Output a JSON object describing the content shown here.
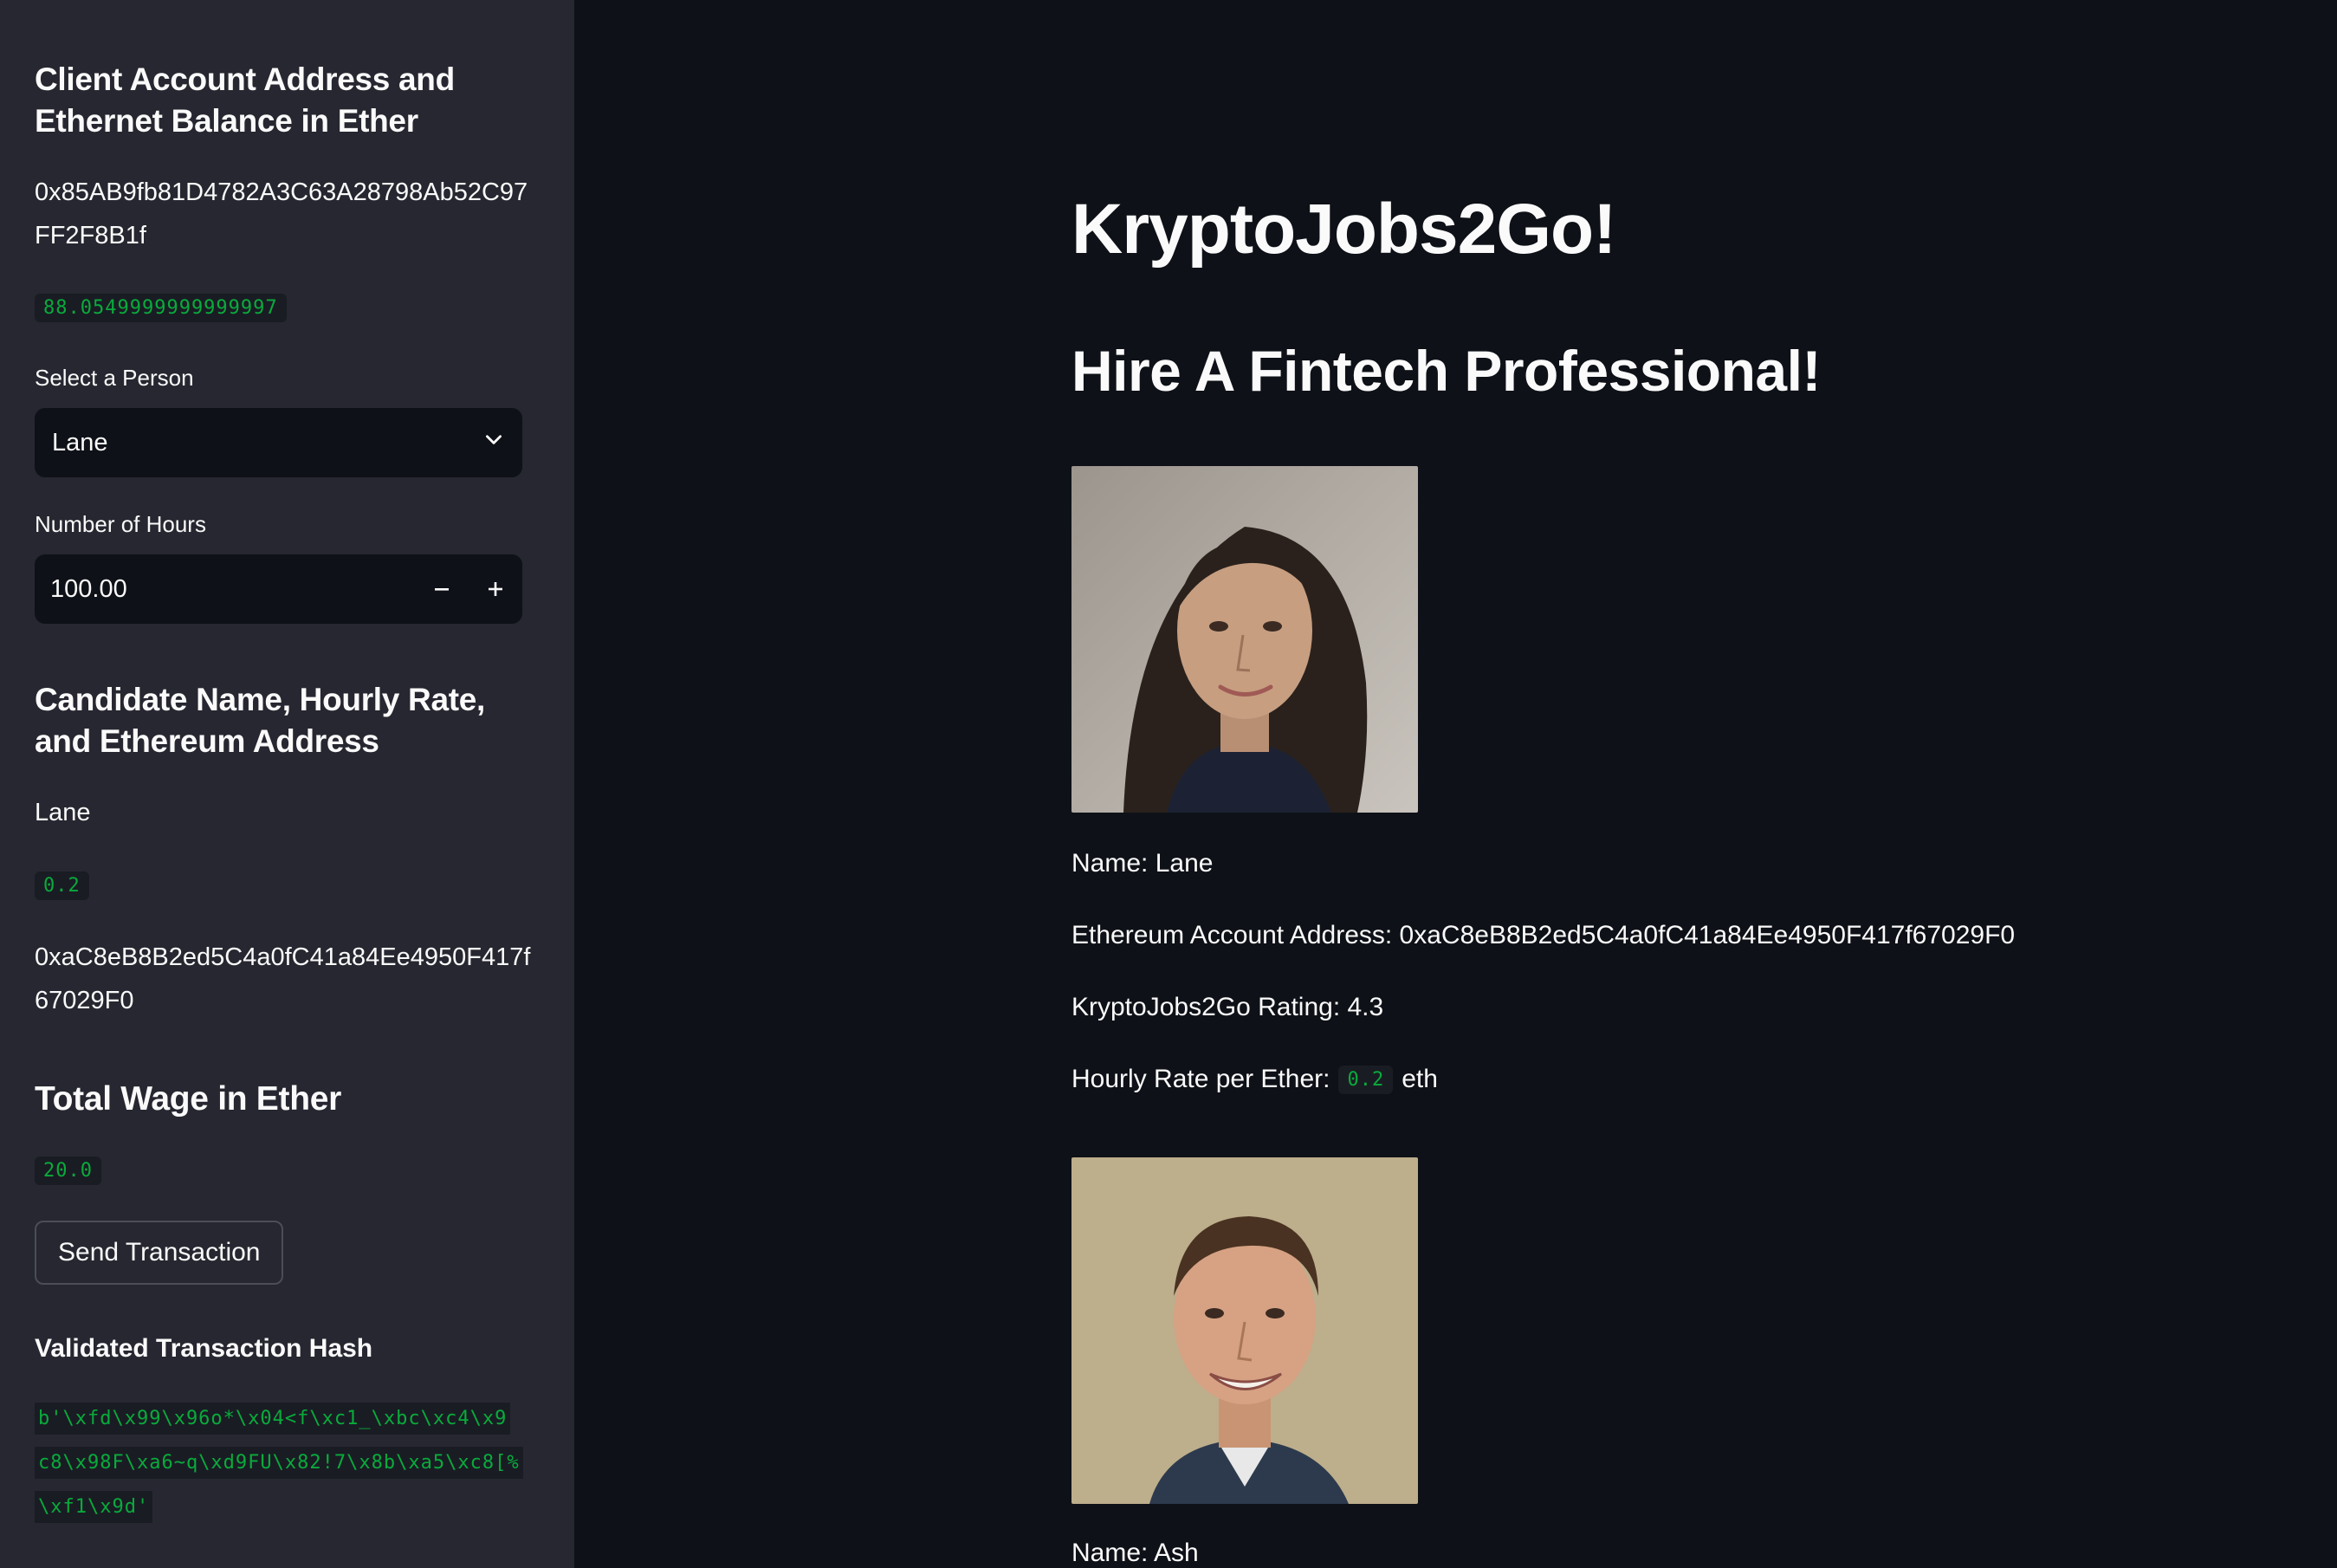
{
  "sidebar": {
    "client_heading": "Client Account Address and Ethernet Balance in Ether",
    "client_address_line1": "0x85AB9fb81D4782A3C63A28798Ab52C97",
    "client_address_line2": "FF2F8B1f",
    "client_balance": "88.0549999999999997",
    "select_label": "Select a Person",
    "select_value": "Lane",
    "hours_label": "Number of Hours",
    "hours_value": "100.00",
    "candidate_heading": "Candidate Name, Hourly Rate, and Ethereum Address",
    "candidate_name": "Lane",
    "candidate_rate": "0.2",
    "candidate_address_line1": "0xaC8eB8B2ed5C4a0fC41a84Ee4950F417f",
    "candidate_address_line2": "67029F0",
    "total_wage_heading": "Total Wage in Ether",
    "total_wage_value": "20.0",
    "send_button": "Send Transaction",
    "tx_hash_heading": "Validated Transaction Hash",
    "tx_hash_line1": "b'\\xfd\\x99\\x96o*\\x04<f\\xc1_\\xbc\\xc4\\x9",
    "tx_hash_line2": "c8\\x98F\\xa6~q\\xd9FU\\x82!7\\x8b\\xa5\\xc8[%",
    "tx_hash_line3": "\\xf1\\x9d'"
  },
  "main": {
    "title": "KryptoJobs2Go!",
    "subtitle": "Hire A Fintech Professional!",
    "candidates": [
      {
        "name_text": "Name: Lane",
        "address_text": "Ethereum Account Address: 0xaC8eB8B2ed5C4a0fC41a84Ee4950F417f67029F0",
        "rating_text": "KryptoJobs2Go Rating: 4.3",
        "rate_prefix": "Hourly Rate per Ether:",
        "rate_value": "0.2",
        "rate_suffix": "eth"
      },
      {
        "name_text": "Name: Ash"
      }
    ]
  },
  "icons": {
    "select_chevron": "chevron-down-icon",
    "decrement": "minus-icon",
    "increment": "plus-icon"
  },
  "colors": {
    "background": "#0e1117",
    "sidebar": "#262730",
    "code_text": "#09ab3b"
  }
}
